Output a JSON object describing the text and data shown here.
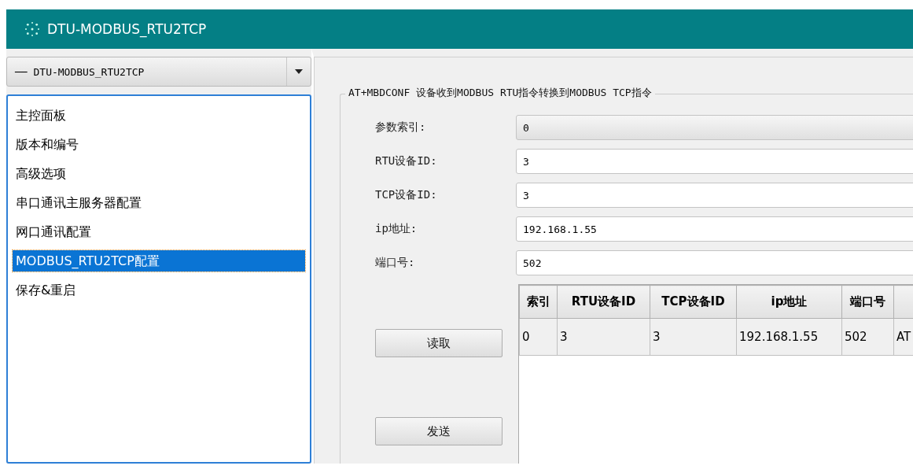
{
  "window": {
    "title": "DTU-MODBUS_RTU2TCP"
  },
  "device_selector": {
    "value": "── DTU-MODBUS_RTU2TCP"
  },
  "sidebar": {
    "items": [
      {
        "label": "主控面板",
        "selected": false
      },
      {
        "label": "版本和编号",
        "selected": false
      },
      {
        "label": "高级选项",
        "selected": false
      },
      {
        "label": "串口通讯主服务器配置",
        "selected": false
      },
      {
        "label": "网口通讯配置",
        "selected": false
      },
      {
        "label": "MODBUS_RTU2TCP配置",
        "selected": true
      },
      {
        "label": "保存&重启",
        "selected": false
      }
    ]
  },
  "group": {
    "title": "AT+MBDCONF 设备收到MODBUS RTU指令转换到MODBUS TCP指令",
    "fields": [
      {
        "label": "参数索引:",
        "value": "0",
        "kind": "combo"
      },
      {
        "label": "RTU设备ID:",
        "value": "3",
        "kind": "text"
      },
      {
        "label": "TCP设备ID:",
        "value": "3",
        "kind": "text"
      },
      {
        "label": "ip地址:",
        "value": "192.168.1.55",
        "kind": "text"
      },
      {
        "label": "端口号:",
        "value": "502",
        "kind": "text"
      }
    ],
    "buttons": [
      "读取",
      "发送"
    ],
    "table": {
      "columns": [
        "索引",
        "RTU设备ID",
        "TCP设备ID",
        "ip地址",
        "端口号"
      ],
      "rows": [
        [
          "0",
          "3",
          "3",
          "192.168.1.55",
          "502",
          "AT"
        ]
      ]
    }
  }
}
